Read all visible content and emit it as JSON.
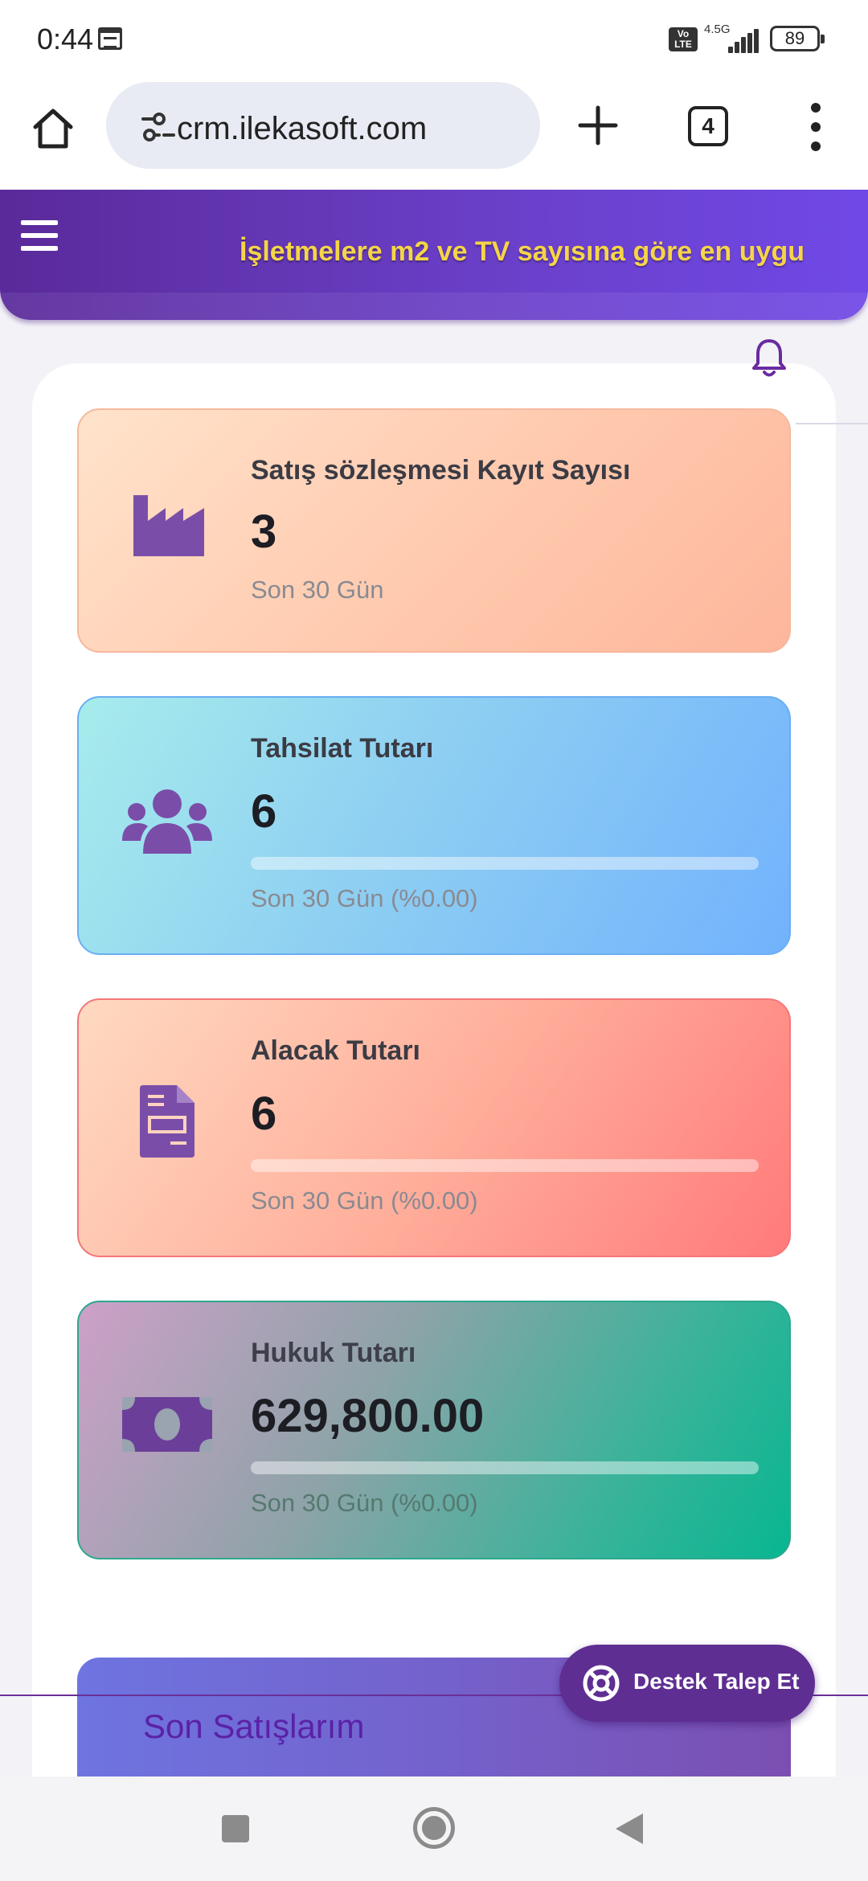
{
  "status_bar": {
    "time": "0:44",
    "volte": "Vo\nLTE",
    "network": "4.5G",
    "battery": "89"
  },
  "browser": {
    "url": "crm.ilekasoft.com",
    "tab_count": "4"
  },
  "header": {
    "marquee": "İşletmelere m2 ve TV sayısına göre en uygu"
  },
  "cards": [
    {
      "title": "Satış sözleşmesi Kayıt Sayısı",
      "value": "3",
      "subtitle": "Son 30 Gün",
      "icon": "industry-icon"
    },
    {
      "title": "Tahsilat Tutarı",
      "value": "6",
      "subtitle": "Son 30 Gün (%0.00)",
      "progress": 0,
      "icon": "users-icon"
    },
    {
      "title": "Alacak Tutarı",
      "value": "6",
      "subtitle": "Son 30 Gün (%0.00)",
      "progress": 0,
      "icon": "invoice-icon"
    },
    {
      "title": "Hukuk Tutarı",
      "value": "629,800.00",
      "subtitle": "Son 30 Gün (%0.00)",
      "progress": 0,
      "icon": "money-bill-icon"
    }
  ],
  "sales": {
    "title": "Son Satışlarım"
  },
  "support": {
    "label": "Destek Talep Et"
  },
  "colors": {
    "brand_purple": "#6a3fc7",
    "marquee_yellow": "#f5d547",
    "icon_purple": "#7a4ea8"
  }
}
